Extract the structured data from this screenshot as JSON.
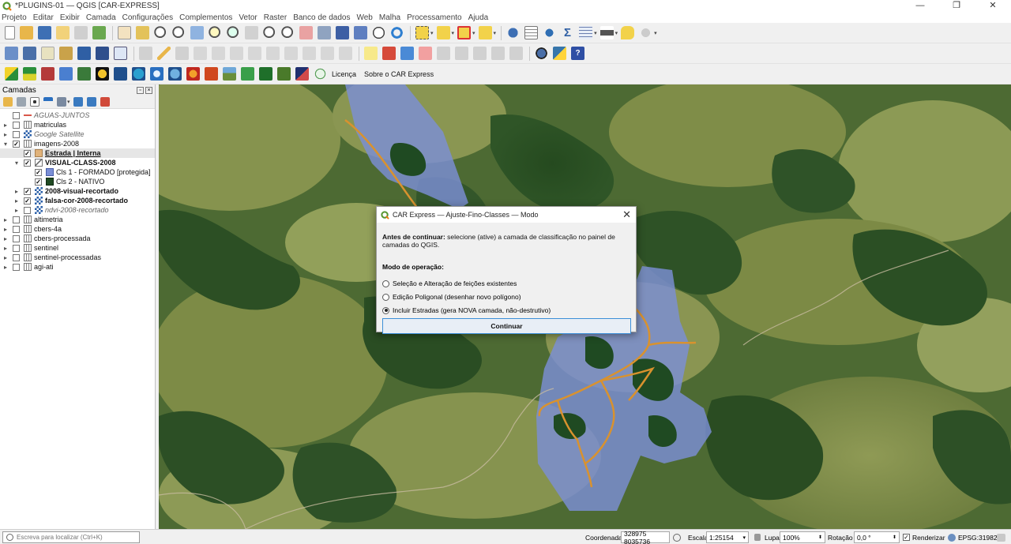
{
  "window": {
    "title": "*PLUGINS-01 — QGIS [CAR-EXPRESS]",
    "controls": [
      "—",
      "❐",
      "✕"
    ]
  },
  "menu": [
    "Projeto",
    "Editar",
    "Exibir",
    "Camada",
    "Configurações",
    "Complementos",
    "Vetor",
    "Raster",
    "Banco de dados",
    "Web",
    "Malha",
    "Processamento",
    "Ajuda"
  ],
  "plugin_toolbar": {
    "licenca": "Licença",
    "sobre": "Sobre o CAR Express"
  },
  "layers_panel": {
    "title": "Camadas",
    "layers": [
      {
        "name": "AGUAS-JUNTOS",
        "indent": 0,
        "expand": "",
        "checked": false,
        "icon": "line",
        "style": "ital"
      },
      {
        "name": "matriculas",
        "indent": 0,
        "expand": "▸",
        "checked": false,
        "icon": "group",
        "style": ""
      },
      {
        "name": "Google Satellite",
        "indent": 0,
        "expand": "▸",
        "checked": false,
        "icon": "raster",
        "style": "ital"
      },
      {
        "name": "imagens-2008",
        "indent": 0,
        "expand": "▾",
        "checked": true,
        "icon": "group",
        "style": ""
      },
      {
        "name": "Estrada | Interna",
        "indent": 1,
        "expand": "",
        "checked": true,
        "icon": "poly-tan",
        "style": "bold-ul",
        "selected": true
      },
      {
        "name": "VISUAL-CLASS-2008",
        "indent": 1,
        "expand": "▾",
        "checked": true,
        "icon": "poly-line",
        "style": "bold"
      },
      {
        "name": "Cls 1 - FORMADO [protegida]",
        "indent": 2,
        "expand": "",
        "checked": true,
        "icon": "sw-blue",
        "style": ""
      },
      {
        "name": "Cls 2 - NATIVO",
        "indent": 2,
        "expand": "",
        "checked": true,
        "icon": "sw-green",
        "style": ""
      },
      {
        "name": "2008-visual-recortado",
        "indent": 1,
        "expand": "▸",
        "checked": true,
        "icon": "raster",
        "style": "bold"
      },
      {
        "name": "falsa-cor-2008-recortado",
        "indent": 1,
        "expand": "▸",
        "checked": true,
        "icon": "raster",
        "style": "bold"
      },
      {
        "name": "ndvi-2008-recortado",
        "indent": 1,
        "expand": "▸",
        "checked": false,
        "icon": "raster",
        "style": "ital"
      },
      {
        "name": "altimetria",
        "indent": 0,
        "expand": "▸",
        "checked": false,
        "icon": "group",
        "style": ""
      },
      {
        "name": "cbers-4a",
        "indent": 0,
        "expand": "▸",
        "checked": false,
        "icon": "group",
        "style": ""
      },
      {
        "name": "cbers-processada",
        "indent": 0,
        "expand": "▸",
        "checked": false,
        "icon": "group",
        "style": ""
      },
      {
        "name": "sentinel",
        "indent": 0,
        "expand": "▸",
        "checked": false,
        "icon": "group",
        "style": ""
      },
      {
        "name": "sentinel-processadas",
        "indent": 0,
        "expand": "▸",
        "checked": false,
        "icon": "group",
        "style": ""
      },
      {
        "name": "agi-ati",
        "indent": 0,
        "expand": "▸",
        "checked": false,
        "icon": "group",
        "style": ""
      }
    ]
  },
  "dialog": {
    "title": "CAR Express — Ajuste-Fino-Classes — Modo",
    "close": "✕",
    "info_bold": "Antes de continuar:",
    "info_text": " selecione (ative) a camada de classificação no painel de camadas do QGIS.",
    "mode_label": "Modo de operação:",
    "options": [
      {
        "label": "Seleção e Alteração de feições existentes",
        "selected": false
      },
      {
        "label": "Edição Poligonal (desenhar novo polígono)",
        "selected": false
      },
      {
        "label": "Incluir Estradas (gera NOVA camada, não-destrutivo)",
        "selected": true
      }
    ],
    "button": "Continuar"
  },
  "statusbar": {
    "locator_placeholder": "Escreva para localizar (Ctrl+K)",
    "coord_label": "Coordenada",
    "coord_value": "328975  8035736",
    "scale_label": "Escala",
    "scale_value": "1:25154",
    "zoom_label": "Lupa",
    "zoom_value": "100%",
    "rotation_label": "Rotação",
    "rotation_value": "0,0 °",
    "render_label": "Renderizar",
    "crs": "EPSG:31982"
  },
  "colors": {
    "class_formado": "#7b8fd6",
    "class_nativo": "#1f4a22",
    "road": "#d9922e",
    "accent": "#3c8fd8"
  }
}
